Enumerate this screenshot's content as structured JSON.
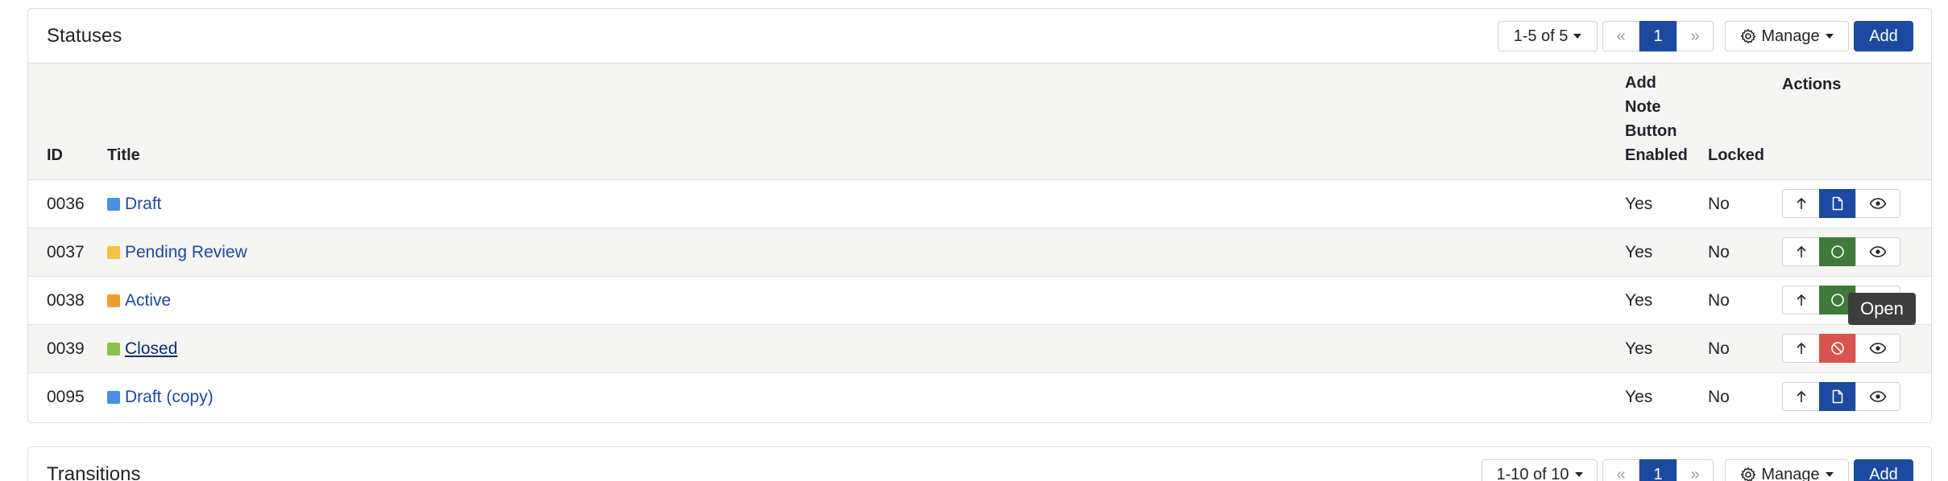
{
  "statuses": {
    "title": "Statuses",
    "range_label": "1-5 of 5",
    "pager": {
      "first": "«",
      "current": "1",
      "last": "»"
    },
    "manage_label": "Manage",
    "add_label": "Add",
    "columns": {
      "id": "ID",
      "title": "Title",
      "note": [
        "Add",
        "Note",
        "Button",
        "Enabled"
      ],
      "locked": "Locked",
      "actions": "Actions"
    },
    "rows": [
      {
        "id": "0036",
        "title": "Draft",
        "color": "#4a90e2",
        "note": "Yes",
        "locked": "No",
        "state": "draft",
        "state_color": "blue"
      },
      {
        "id": "0037",
        "title": "Pending Review",
        "color": "#f5c342",
        "note": "Yes",
        "locked": "No",
        "state": "open",
        "state_color": "green"
      },
      {
        "id": "0038",
        "title": "Active",
        "color": "#f39c33",
        "note": "Yes",
        "locked": "No",
        "state": "open",
        "state_color": "green"
      },
      {
        "id": "0039",
        "title": "Closed",
        "color": "#8bc34a",
        "note": "Yes",
        "locked": "No",
        "state": "closed",
        "state_color": "red"
      },
      {
        "id": "0095",
        "title": "Draft (copy)",
        "color": "#4a90e2",
        "note": "Yes",
        "locked": "No",
        "state": "draft",
        "state_color": "blue"
      }
    ],
    "tooltip": "Open"
  },
  "transitions": {
    "title": "Transitions",
    "range_label": "1-10 of 10",
    "pager": {
      "first": "«",
      "current": "1",
      "last": "»"
    },
    "manage_label": "Manage",
    "add_label": "Add"
  }
}
